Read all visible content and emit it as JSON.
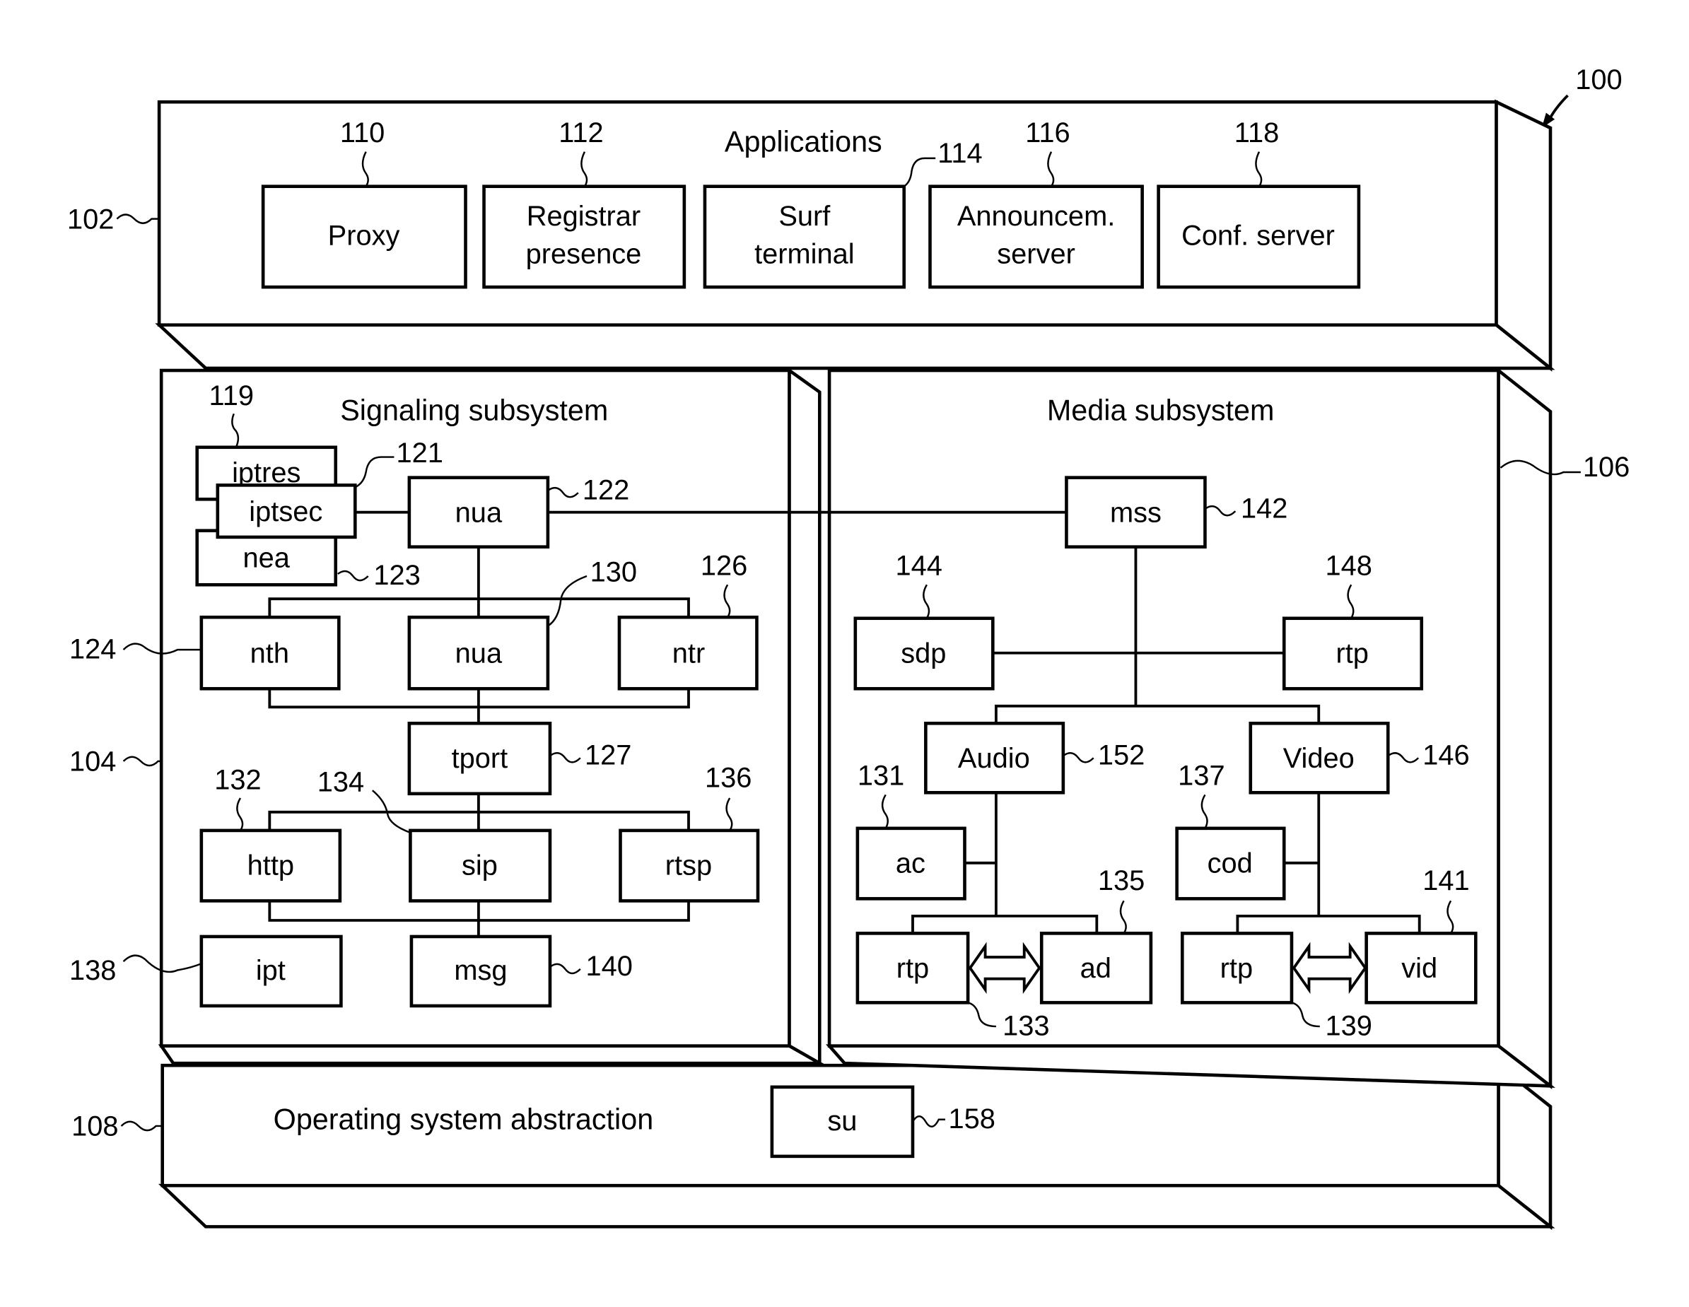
{
  "figure_ref": "100",
  "layers": {
    "applications": {
      "ref": "102",
      "title": "Applications",
      "components": [
        {
          "ref": "110",
          "line1": "Proxy",
          "line2": ""
        },
        {
          "ref": "112",
          "line1": "Registrar",
          "line2": "presence"
        },
        {
          "ref": "114",
          "line1": "Surf",
          "line2": "terminal"
        },
        {
          "ref": "116",
          "line1": "Announcem.",
          "line2": "server"
        },
        {
          "ref": "118",
          "line1": "Conf. server",
          "line2": ""
        }
      ]
    },
    "signaling": {
      "ref": "104",
      "title": "Signaling subsystem",
      "components": {
        "iptres": {
          "ref": "119",
          "label": "iptres"
        },
        "iptsec": {
          "ref": "121",
          "label": "iptsec"
        },
        "nea": {
          "ref": "123",
          "label": "nea"
        },
        "nua_top": {
          "ref": "122",
          "label": "nua"
        },
        "nth": {
          "ref": "124",
          "label": "nth"
        },
        "nua_mid": {
          "ref": "130",
          "label": "nua"
        },
        "ntr": {
          "ref": "126",
          "label": "ntr"
        },
        "tport": {
          "ref": "127",
          "label": "tport"
        },
        "http": {
          "ref": "132",
          "label": "http"
        },
        "sip": {
          "ref": "134",
          "label": "sip"
        },
        "rtsp": {
          "ref": "136",
          "label": "rtsp"
        },
        "ipt": {
          "ref": "138",
          "label": "ipt"
        },
        "msg": {
          "ref": "140",
          "label": "msg"
        }
      }
    },
    "media": {
      "ref": "106",
      "title": "Media subsystem",
      "components": {
        "mss": {
          "ref": "142",
          "label": "mss"
        },
        "sdp": {
          "ref": "144",
          "label": "sdp"
        },
        "rtp_top": {
          "ref": "148",
          "label": "rtp"
        },
        "audio": {
          "ref": "152",
          "label": "Audio"
        },
        "video": {
          "ref": "146",
          "label": "Video"
        },
        "ac": {
          "ref": "131",
          "label": "ac"
        },
        "cod": {
          "ref": "137",
          "label": "cod"
        },
        "rtp_audio": {
          "ref": "133",
          "label": "rtp"
        },
        "ad": {
          "ref": "135",
          "label": "ad"
        },
        "rtp_video": {
          "ref": "139",
          "label": "rtp"
        },
        "vid": {
          "ref": "141",
          "label": "vid"
        }
      }
    },
    "os": {
      "ref": "108",
      "title": "Operating system abstraction",
      "components": {
        "su": {
          "ref": "158",
          "label": "su"
        }
      }
    }
  }
}
